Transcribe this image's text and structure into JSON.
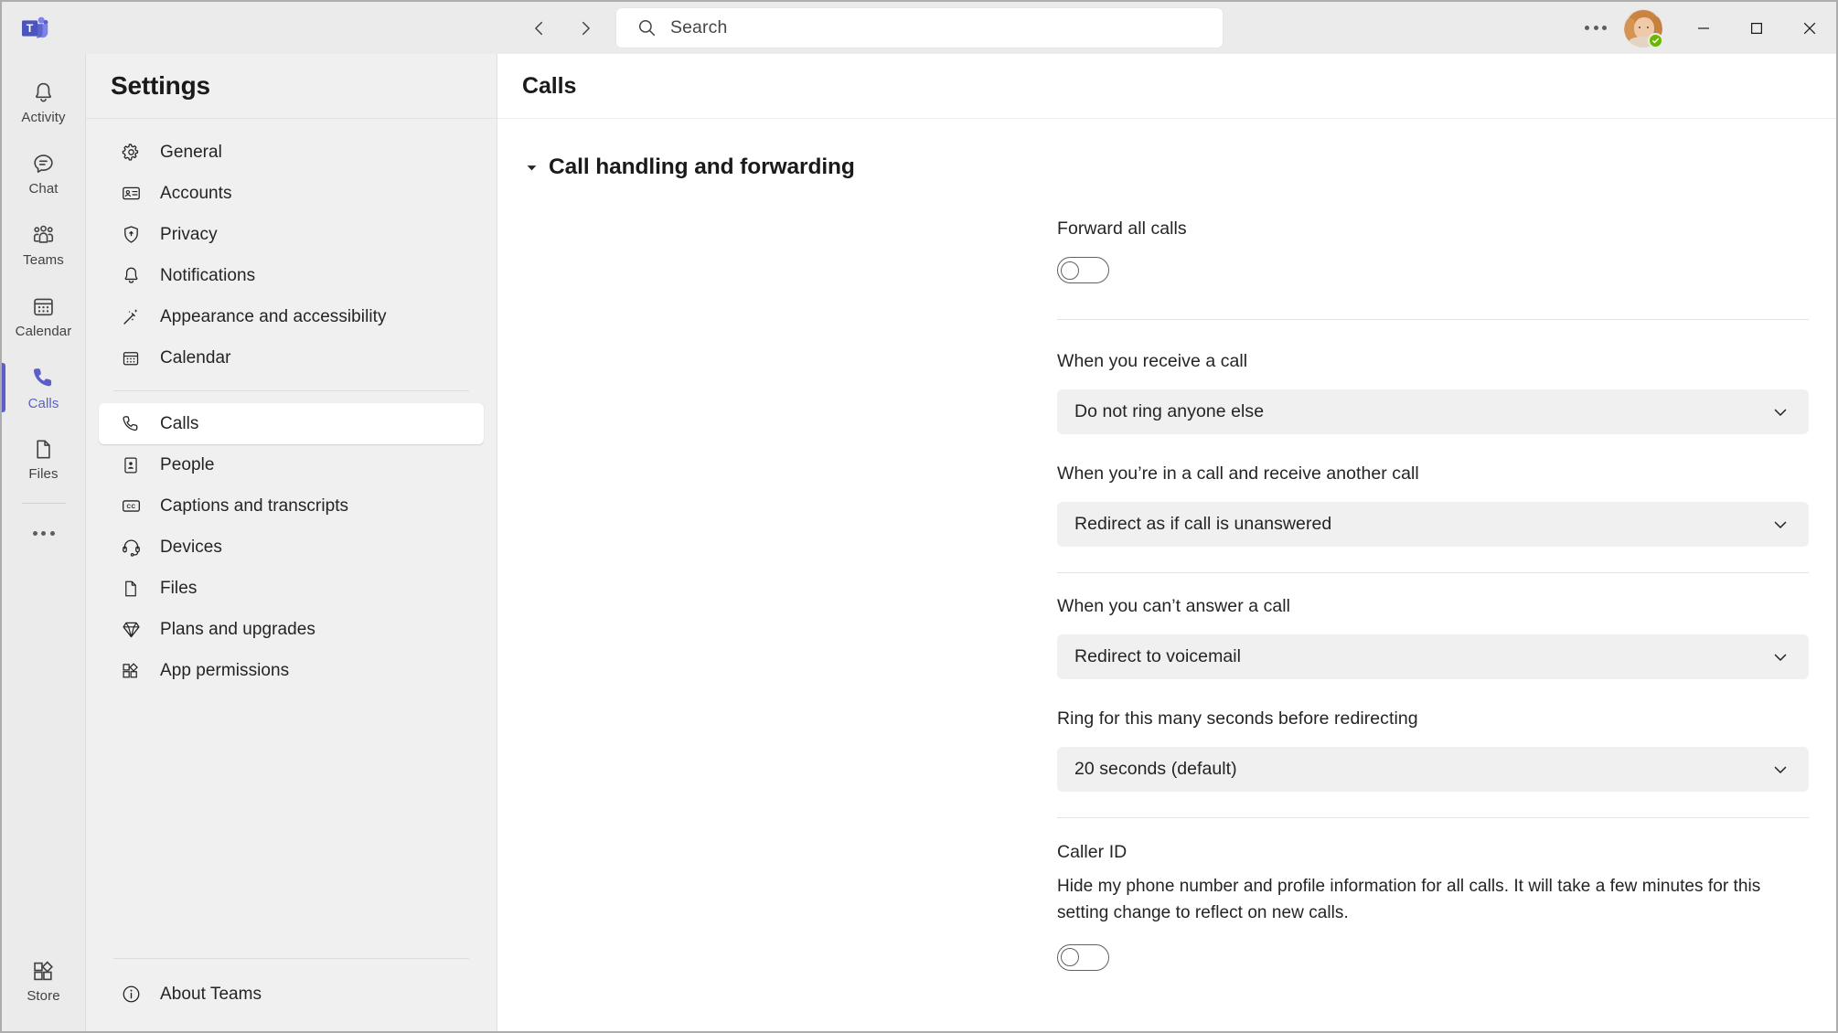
{
  "window": {
    "logo": "teams-logo",
    "nav": {
      "back": "back-icon",
      "forward": "forward-icon"
    },
    "search": {
      "placeholder": "Search",
      "value": ""
    },
    "overflow_label": "…",
    "controls": {
      "minimize": "minimize",
      "maximize": "maximize",
      "close": "close"
    },
    "presence": "Available"
  },
  "rail": {
    "items": [
      {
        "label": "Activity",
        "icon": "bell-icon",
        "active": false
      },
      {
        "label": "Chat",
        "icon": "chat-icon",
        "active": false
      },
      {
        "label": "Teams",
        "icon": "teams-people-icon",
        "active": false
      },
      {
        "label": "Calendar",
        "icon": "calendar-icon",
        "active": false
      },
      {
        "label": "Calls",
        "icon": "phone-icon",
        "active": true
      },
      {
        "label": "Files",
        "icon": "file-icon",
        "active": false
      }
    ],
    "more": "more-apps-icon",
    "store": {
      "label": "Store",
      "icon": "store-icon"
    },
    "accent": "#5b5fc7"
  },
  "settings": {
    "title": "Settings",
    "items": [
      {
        "label": "General",
        "icon": "gear-icon",
        "selected": false
      },
      {
        "label": "Accounts",
        "icon": "id-card-icon",
        "selected": false
      },
      {
        "label": "Privacy",
        "icon": "shield-icon",
        "selected": false
      },
      {
        "label": "Notifications",
        "icon": "bell-icon",
        "selected": false
      },
      {
        "label": "Appearance and accessibility",
        "icon": "magic-wand-icon",
        "selected": false
      },
      {
        "label": "Calendar",
        "icon": "calendar-icon",
        "selected": false
      },
      {
        "label": "Calls",
        "icon": "phone-icon",
        "selected": true
      },
      {
        "label": "People",
        "icon": "contact-card-icon",
        "selected": false
      },
      {
        "label": "Captions and transcripts",
        "icon": "closed-caption-icon",
        "selected": false
      },
      {
        "label": "Devices",
        "icon": "headset-icon",
        "selected": false
      },
      {
        "label": "Files",
        "icon": "file-icon",
        "selected": false
      },
      {
        "label": "Plans and upgrades",
        "icon": "diamond-icon",
        "selected": false
      },
      {
        "label": "App permissions",
        "icon": "app-grid-icon",
        "selected": false
      }
    ],
    "about": {
      "label": "About Teams",
      "icon": "info-icon"
    }
  },
  "main": {
    "page_title": "Calls",
    "section": {
      "title": "Call handling and forwarding",
      "expanded": true,
      "caret": "chevron-down-icon"
    },
    "forward_all": {
      "label": "Forward all calls",
      "toggle_state": "off"
    },
    "fields": [
      {
        "label": "When you receive a call",
        "value": "Do not ring anyone else",
        "chevron": "chevron-down-icon"
      },
      {
        "label": "When you’re in a call and receive another call",
        "value": "Redirect as if call is unanswered",
        "chevron": "chevron-down-icon"
      },
      {
        "label": "When you can’t answer a call",
        "value": "Redirect to voicemail",
        "chevron": "chevron-down-icon"
      },
      {
        "label": "Ring for this many seconds before redirecting",
        "value": "20 seconds (default)",
        "chevron": "chevron-down-icon"
      }
    ],
    "caller_id": {
      "title": "Caller ID",
      "description": "Hide my phone number and profile information for all calls. It will take a few minutes for this setting change to reflect on new calls.",
      "toggle_state": "off"
    }
  },
  "colors": {
    "accent": "#5b5fc7",
    "chrome": "#ebebeb",
    "pane": "#f0f0f0",
    "presence_green": "#6bb700",
    "text": "#242424"
  }
}
